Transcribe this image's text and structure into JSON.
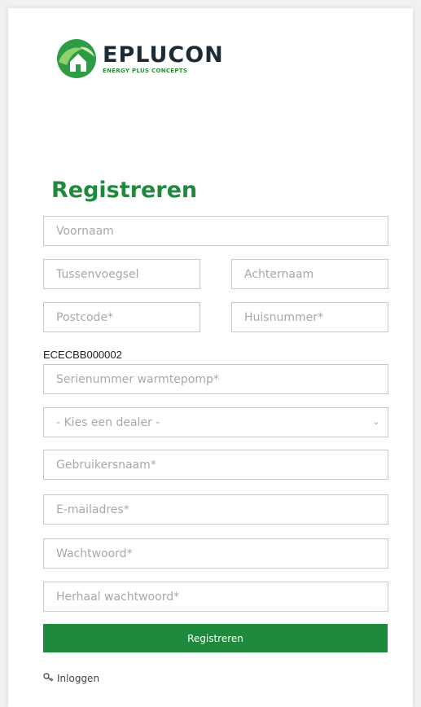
{
  "logo": {
    "brand": "EPLUCON",
    "tagline": "ENERGY PLUS CONCEPTS"
  },
  "page": {
    "title": "Registreren"
  },
  "form": {
    "voornaam": {
      "placeholder": "Voornaam"
    },
    "tussenvoegsel": {
      "placeholder": "Tussenvoegsel"
    },
    "achternaam": {
      "placeholder": "Achternaam"
    },
    "postcode": {
      "placeholder": "Postcode*"
    },
    "huisnummer": {
      "placeholder": "Huisnummer*"
    },
    "serial_label": "ECECBB000002",
    "serienummer": {
      "placeholder": "Serienummer warmtepomp*"
    },
    "dealer": {
      "selected": "- Kies een dealer -"
    },
    "gebruikersnaam": {
      "placeholder": "Gebruikersnaam*"
    },
    "email": {
      "placeholder": "E-mailadres*"
    },
    "wachtwoord": {
      "placeholder": "Wachtwoord*"
    },
    "herhaal": {
      "placeholder": "Herhaal wachtwoord*"
    },
    "submit_label": "Registreren"
  },
  "links": {
    "login": "Inloggen"
  },
  "colors": {
    "accent": "#1f8a3c",
    "border": "#c8c8c8",
    "placeholder": "#a8a8a8"
  },
  "icons": {
    "dropdown": "chevron-down-icon",
    "login": "key-icon",
    "logo": "house-leaf-icon"
  }
}
